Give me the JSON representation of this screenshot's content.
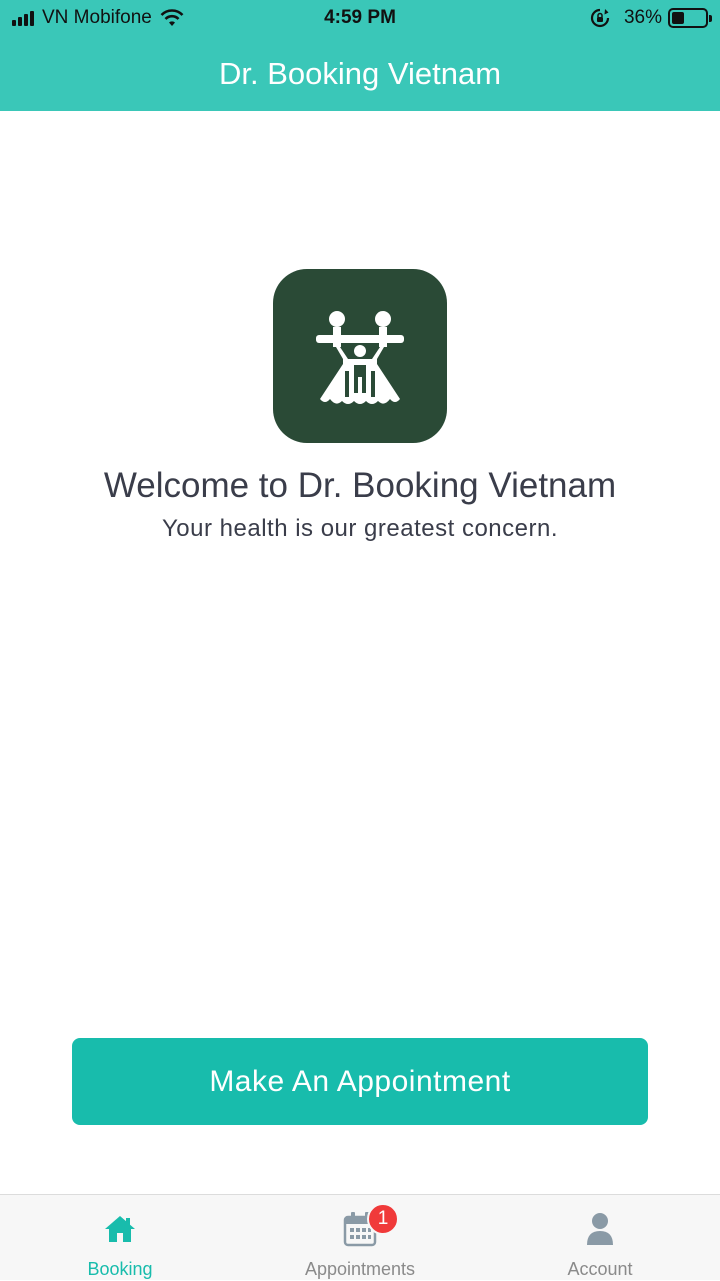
{
  "status_bar": {
    "carrier": "VN Mobifone",
    "time": "4:59 PM",
    "battery_percent": "36%",
    "battery_level": 0.36
  },
  "nav": {
    "title": "Dr. Booking Vietnam"
  },
  "main": {
    "logo_icon": "family-logo-icon",
    "welcome_title": "Welcome to Dr. Booking Vietnam",
    "welcome_subtitle": "Your health is our greatest concern.",
    "cta_label": "Make An Appointment"
  },
  "tabs": [
    {
      "label": "Booking",
      "icon": "home-icon",
      "active": true
    },
    {
      "label": "Appointments",
      "icon": "calendar-icon",
      "badge": "1"
    },
    {
      "label": "Account",
      "icon": "user-icon"
    }
  ],
  "colors": {
    "brand": "#3ac7b8",
    "button": "#18bcac",
    "logo_bg": "#2a4a36",
    "badge": "#f03a3a"
  }
}
